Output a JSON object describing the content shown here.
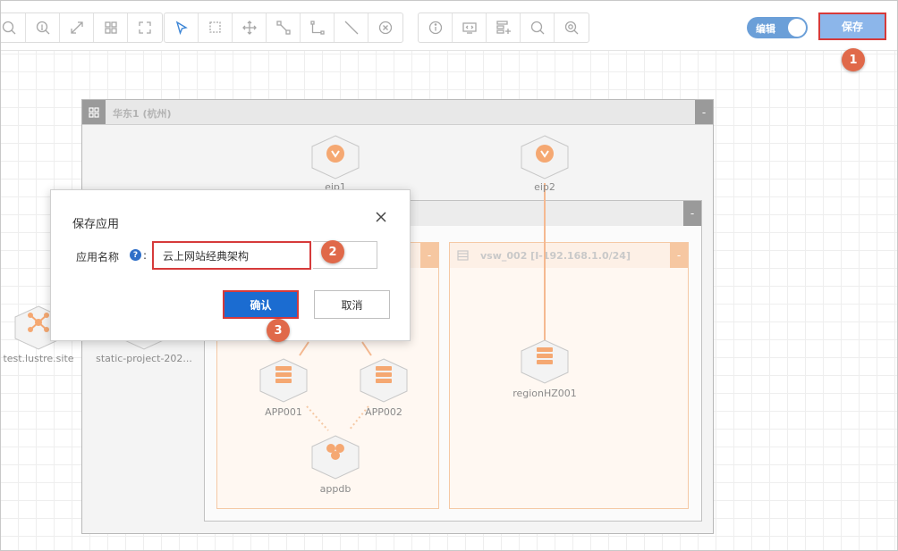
{
  "toolbar": {
    "toggle_label": "编辑",
    "save_label": "保存"
  },
  "markers": [
    "1",
    "2",
    "3"
  ],
  "region": {
    "title": "华东1 (杭州)",
    "collapse_symbol": "-"
  },
  "vpc": {
    "collapse_symbol": "-"
  },
  "vsw1": {
    "collapse_symbol": "-"
  },
  "vsw2": {
    "title": "vsw_002 [I-192.168.1.0/24]",
    "collapse_symbol": "-"
  },
  "nodes": {
    "eip1": "eip1",
    "eip2": "eip2",
    "app001": "APP001",
    "app002": "APP002",
    "appdb": "appdb",
    "region_hz001": "regionHZ001",
    "test_lustre": "test.lustre.site",
    "static_project": "static-project-202..."
  },
  "dialog": {
    "title": "保存应用",
    "field_label": "应用名称",
    "colon": ":",
    "help_symbol": "?",
    "input_value": "云上网站经典架构",
    "confirm_label": "确认",
    "cancel_label": "取消"
  },
  "colors": {
    "accent": "#1b6cd1",
    "highlight": "#d63a3a",
    "marker": "#e0694a",
    "node_orange": "#f5a872"
  },
  "icons": [
    "zoom-out-icon",
    "zoom-in-icon",
    "fit-icon",
    "grid-icon",
    "fullscreen-icon",
    "select-icon",
    "box-select-icon",
    "move-icon",
    "connect-icon",
    "connector-icon",
    "line-icon",
    "delete-icon",
    "info-icon",
    "code-icon",
    "layout-icon",
    "search-icon",
    "search-settings-icon",
    "close-icon",
    "help-icon",
    "server-icon",
    "eip-icon",
    "database-icon",
    "network-icon"
  ]
}
